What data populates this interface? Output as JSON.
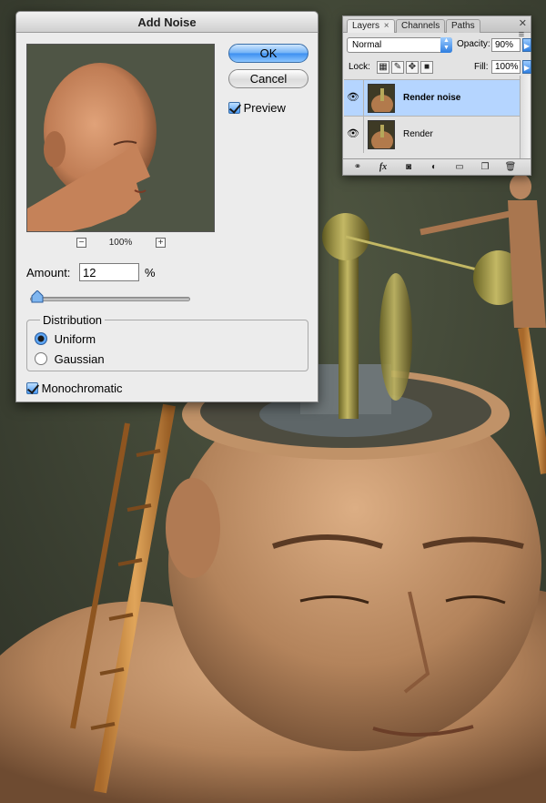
{
  "dialog": {
    "title": "Add Noise",
    "ok_label": "OK",
    "cancel_label": "Cancel",
    "preview_label": "Preview",
    "preview_checked": true,
    "zoom_minus": "−",
    "zoom_level": "100%",
    "zoom_plus": "+",
    "amount_label": "Amount:",
    "amount_value": "12",
    "amount_unit": "%",
    "amount_slider_fraction": 0.03,
    "distribution_label": "Distribution",
    "distribution_options": [
      "Uniform",
      "Gaussian"
    ],
    "distribution_selected": "Uniform",
    "monochromatic_label": "Monochromatic",
    "monochromatic_checked": true
  },
  "layers_panel": {
    "tabs": [
      "Layers",
      "Channels",
      "Paths"
    ],
    "active_tab": "Layers",
    "tab_close": "×",
    "blend_mode": "Normal",
    "opacity_label": "Opacity:",
    "opacity_value": "90%",
    "lock_label": "Lock:",
    "fill_label": "Fill:",
    "fill_value": "100%",
    "layers": [
      {
        "name": "Render noise",
        "visible": true,
        "selected": true
      },
      {
        "name": "Render",
        "visible": true,
        "selected": false
      }
    ],
    "bottom_tools": [
      "link-layers-icon",
      "fx-icon",
      "mask-icon",
      "adjustment-icon",
      "group-icon",
      "new-layer-icon",
      "trash-icon"
    ],
    "fx_label": "fx"
  },
  "colors": {
    "accent_blue": "#3b8ef0",
    "selected_row": "#b5d5ff",
    "dialog_bg": "#ececec",
    "artwork_wall": "#3c4133"
  }
}
